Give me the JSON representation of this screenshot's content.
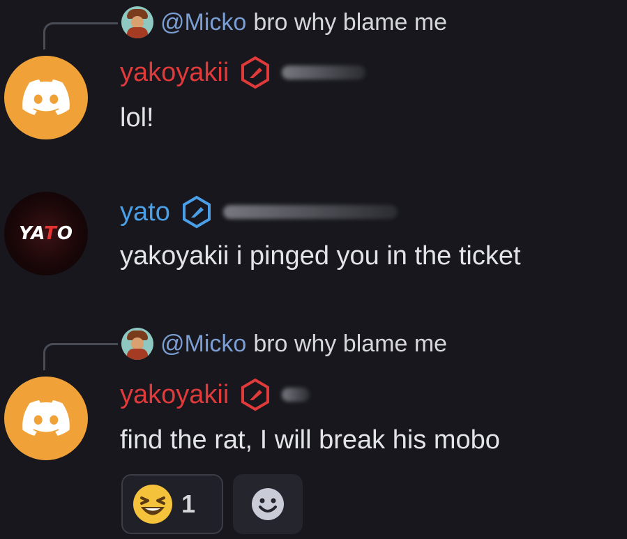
{
  "messages": [
    {
      "reply": {
        "mention": "@Micko",
        "text": "bro why blame me"
      },
      "author": "yakoyakii",
      "content": "lol!"
    },
    {
      "author": "yato",
      "avatar_text": {
        "left": "YA",
        "accent": "T",
        "right": "O"
      },
      "content": "yakoyakii i pinged you in the ticket"
    },
    {
      "reply": {
        "mention": "@Micko",
        "text": "bro why blame me"
      },
      "author": "yakoyakii",
      "content": "find the rat, I will break his mobo",
      "reactions": [
        {
          "emoji": "laughing-emoji-icon",
          "count": "1"
        }
      ]
    }
  ],
  "colors": {
    "background": "#17171d",
    "author_red": "#e03a3a",
    "author_blue": "#4a9fe6",
    "mention": "#7b9fd4",
    "discord_avatar": "#f0a238"
  },
  "icons": {
    "add_reaction": "smiley-add-reaction-icon",
    "badge_red": "hexagon-badge-red-icon",
    "badge_blue": "hexagon-badge-blue-icon"
  }
}
